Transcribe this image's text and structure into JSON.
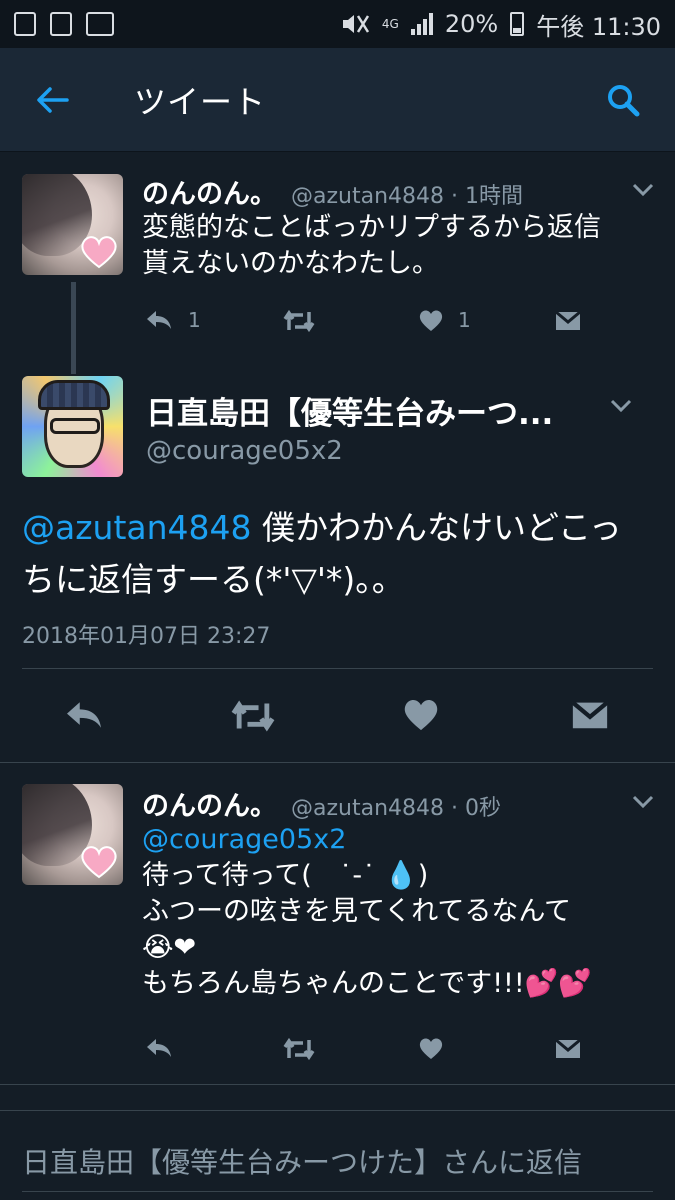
{
  "status_bar": {
    "network": "4G",
    "battery": "20%",
    "time": "午後 11:30"
  },
  "header": {
    "title": "ツイート",
    "back_icon": "arrow-left-icon",
    "search_icon": "search-icon",
    "accent": "#1da1f2"
  },
  "tweet1": {
    "name": "のんのん。",
    "handle": "@azutan4848 · 1時間",
    "text_line1": "変態的なことばっかリプするから返信",
    "text_line2": "貰えないのかなわたし。",
    "reply_count": "1",
    "like_count": "1"
  },
  "main_tweet": {
    "name": "日直島田【優等生台みーつ...",
    "handle": "@courage05x2",
    "mention": "@azutan4848",
    "text_part1": " 僕かわかんなけいどこっ",
    "text_line2": "ちに返信すーる(*'▽'*)。。",
    "date": "2018年01月07日 23:27"
  },
  "tweet2": {
    "name": "のんのん。",
    "handle": "@azutan4848 · 0秒",
    "mention": "@courage05x2",
    "line1": "待って待って(　˙-˙ 💧)",
    "line2": "ふつーの呟きを見てくれてるなんて",
    "line3": "😭❤",
    "line4": "もちろん島ちゃんのことです!!!💕💕"
  },
  "reply_bar": {
    "placeholder": "日直島田【優等生台みーつけた】さんに返信"
  },
  "colors": {
    "background": "#141d26",
    "header": "#1b2836",
    "muted": "#8899a6",
    "link": "#1da1f2"
  }
}
